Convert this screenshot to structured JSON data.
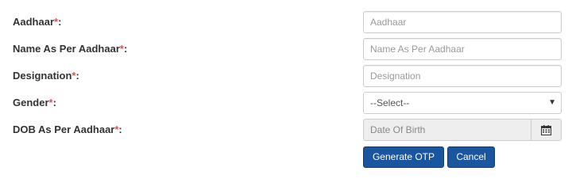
{
  "form": {
    "fields": [
      {
        "label": "Aadhaar",
        "required_mark": "*",
        "colon": ":",
        "placeholder": "Aadhaar",
        "value": ""
      },
      {
        "label": "Name As Per Aadhaar",
        "required_mark": "*",
        "colon": ":",
        "placeholder": "Name As Per Aadhaar",
        "value": ""
      },
      {
        "label": "Designation",
        "required_mark": "*",
        "colon": ":",
        "placeholder": "Designation",
        "value": ""
      },
      {
        "label": "Gender",
        "required_mark": "*",
        "colon": ":",
        "selected": "--Select--"
      },
      {
        "label": "DOB As Per Aadhaar",
        "required_mark": "*",
        "colon": ":",
        "placeholder": "Date Of Birth",
        "value": ""
      }
    ],
    "buttons": {
      "generate_otp": "Generate OTP",
      "cancel": "Cancel"
    },
    "icons": {
      "select_arrow": "caret-down-icon",
      "calendar": "calendar-icon"
    },
    "colors": {
      "required": "#d9534f",
      "button_primary": "#1a56a0",
      "readonly_bg": "#eeeeee"
    }
  }
}
